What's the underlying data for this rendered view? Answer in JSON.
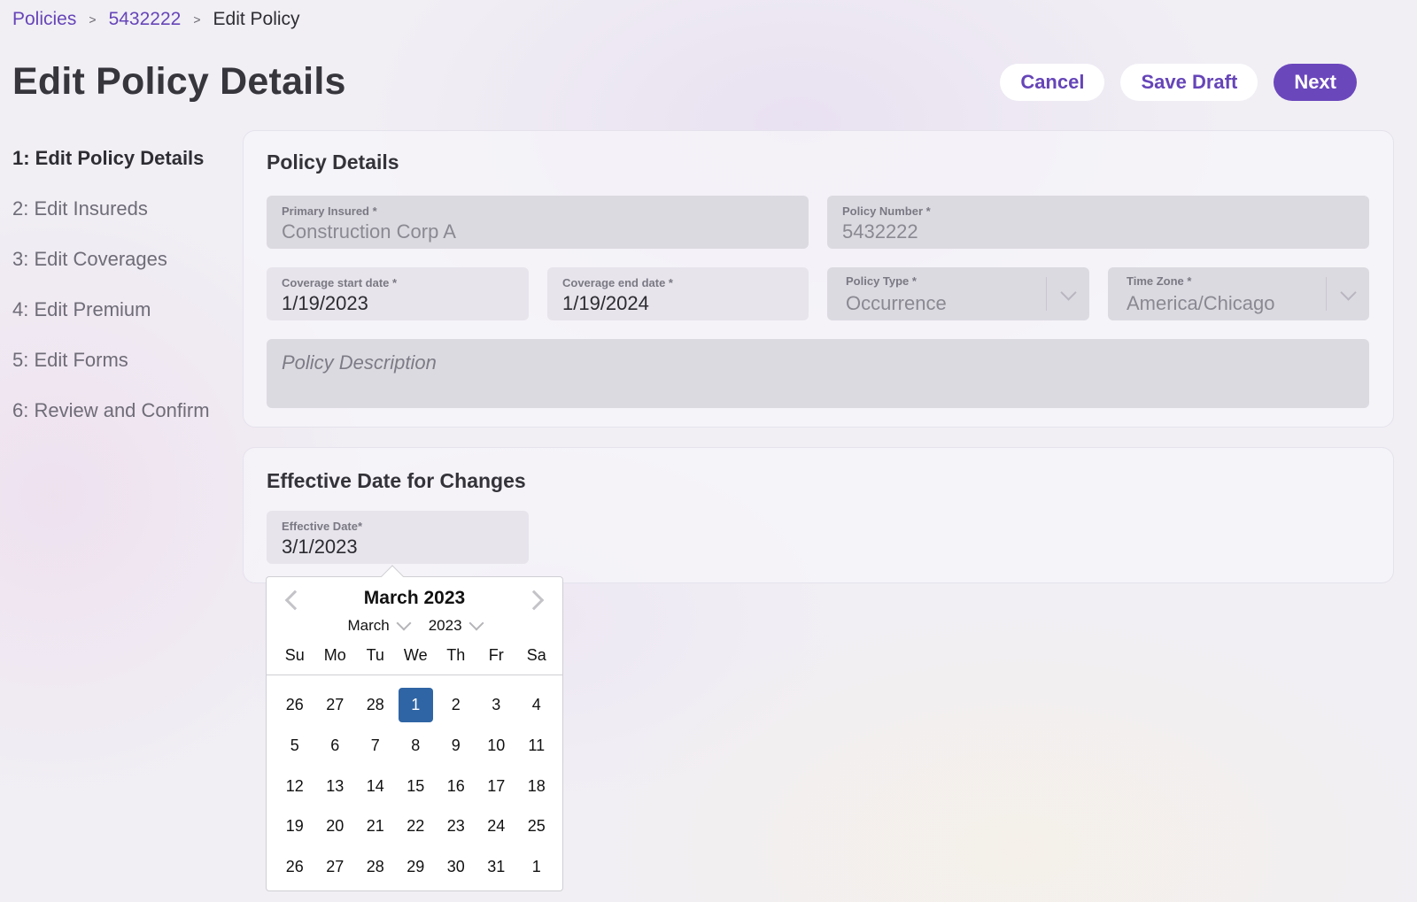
{
  "breadcrumb": {
    "items": [
      "Policies",
      "5432222"
    ],
    "separator": ">",
    "current": "Edit Policy"
  },
  "header": {
    "title": "Edit Policy Details",
    "cancel_label": "Cancel",
    "save_draft_label": "Save Draft",
    "next_label": "Next"
  },
  "steps": [
    {
      "label": "1: Edit Policy Details",
      "active": true
    },
    {
      "label": "2: Edit Insureds",
      "active": false
    },
    {
      "label": "3: Edit Coverages",
      "active": false
    },
    {
      "label": "4: Edit Premium",
      "active": false
    },
    {
      "label": "5: Edit Forms",
      "active": false
    },
    {
      "label": "6: Review and Confirm",
      "active": false
    }
  ],
  "policy_details": {
    "title": "Policy Details",
    "primary_insured": {
      "label": "Primary Insured *",
      "value": "Construction Corp A"
    },
    "policy_number": {
      "label": "Policy Number *",
      "value": "5432222"
    },
    "coverage_start": {
      "label": "Coverage start date *",
      "value": "1/19/2023"
    },
    "coverage_end": {
      "label": "Coverage end date *",
      "value": "1/19/2024"
    },
    "policy_type": {
      "label": "Policy Type *",
      "value": "Occurrence"
    },
    "time_zone": {
      "label": "Time Zone *",
      "value": "America/Chicago"
    },
    "description": {
      "placeholder": "Policy Description"
    }
  },
  "effective": {
    "title": "Effective Date for Changes",
    "effective_date": {
      "label": "Effective Date*",
      "value": "3/1/2023"
    }
  },
  "datepicker": {
    "month_title": "March 2023",
    "month_select": "March",
    "year_select": "2023",
    "weekdays": [
      "Su",
      "Mo",
      "Tu",
      "We",
      "Th",
      "Fr",
      "Sa"
    ],
    "days": [
      "26",
      "27",
      "28",
      "1",
      "2",
      "3",
      "4",
      "5",
      "6",
      "7",
      "8",
      "9",
      "10",
      "11",
      "12",
      "13",
      "14",
      "15",
      "16",
      "17",
      "18",
      "19",
      "20",
      "21",
      "22",
      "23",
      "24",
      "25",
      "26",
      "27",
      "28",
      "29",
      "30",
      "31",
      "1"
    ],
    "selected_index": 3
  },
  "colors": {
    "accent": "#6b47bc",
    "selected_day": "#2f65a4"
  }
}
